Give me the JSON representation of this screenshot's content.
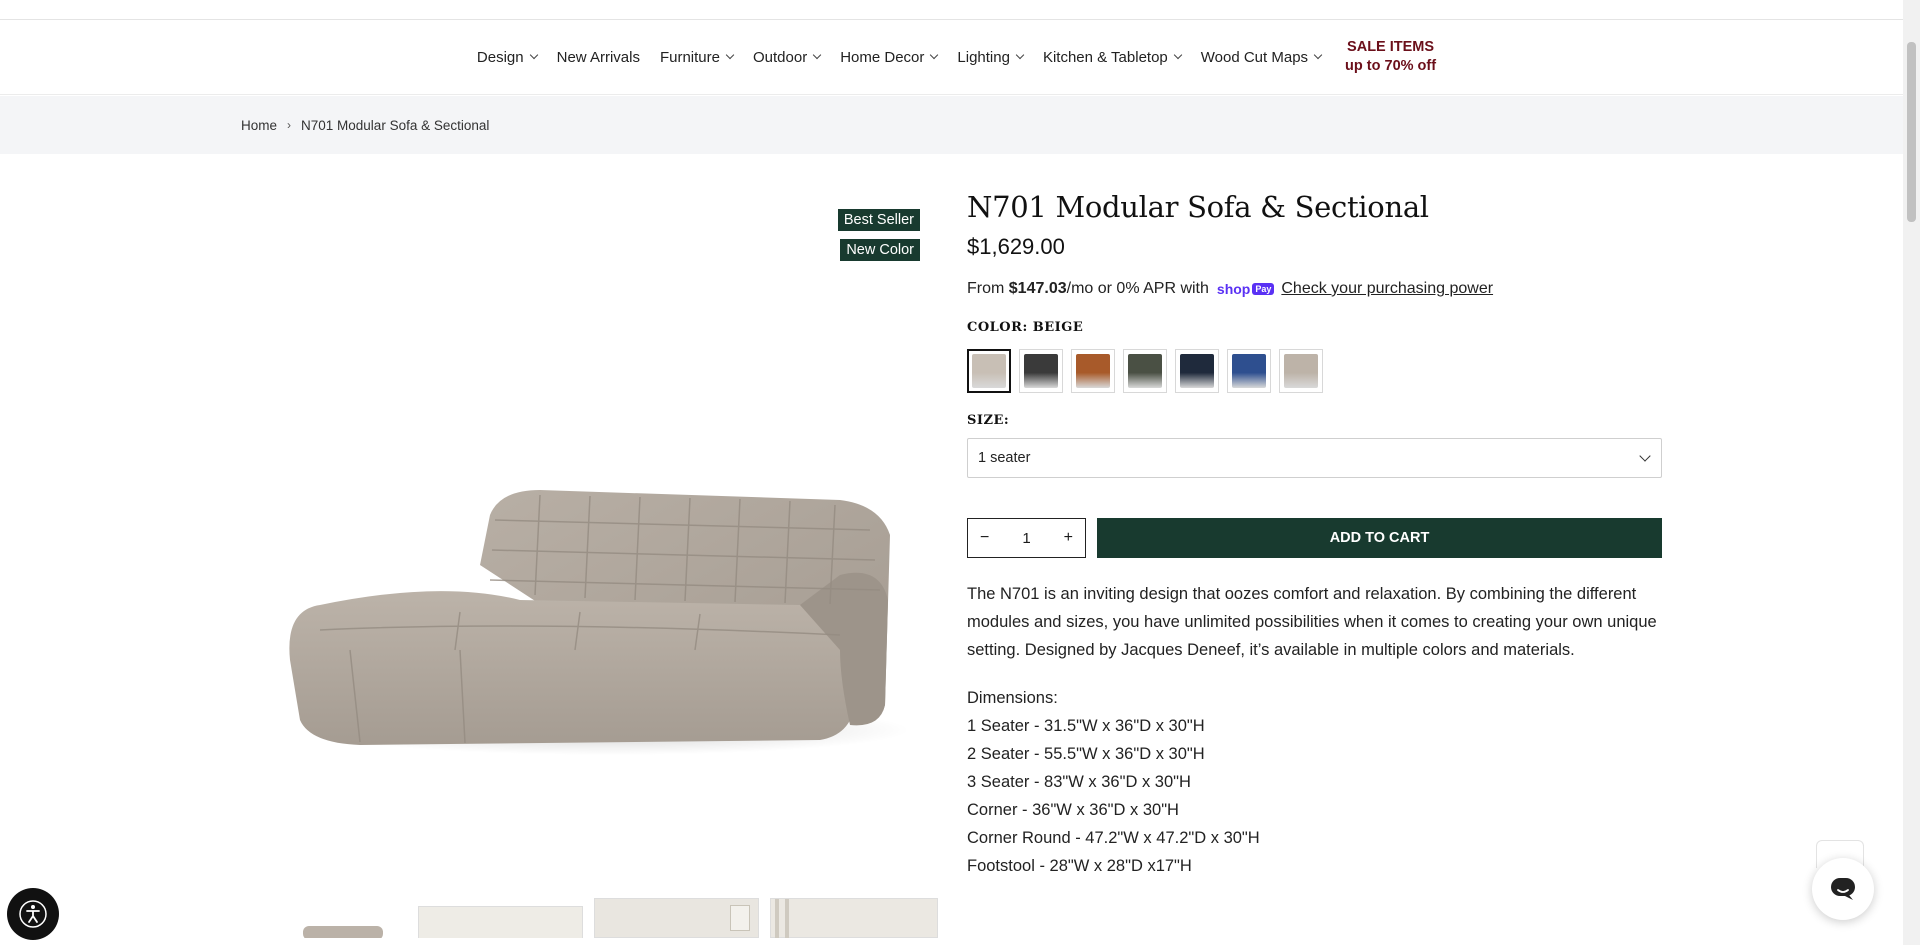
{
  "nav": {
    "items": [
      {
        "label": "Design",
        "dropdown": true
      },
      {
        "label": "New Arrivals",
        "dropdown": false
      },
      {
        "label": "Furniture",
        "dropdown": true
      },
      {
        "label": "Outdoor",
        "dropdown": true
      },
      {
        "label": "Home Decor",
        "dropdown": true
      },
      {
        "label": "Lighting",
        "dropdown": true
      },
      {
        "label": "Kitchen & Tabletop",
        "dropdown": true
      },
      {
        "label": "Wood Cut Maps",
        "dropdown": true
      }
    ],
    "sale_line1": "SALE ITEMS",
    "sale_line2": "up to 70% off"
  },
  "breadcrumb": {
    "home": "Home",
    "separator": "›",
    "current": "N701 Modular Sofa & Sectional"
  },
  "badges": {
    "best_seller": "Best Seller",
    "new_color": "New Color"
  },
  "product": {
    "title": "N701 Modular Sofa & Sectional",
    "price": "$1,629.00",
    "finance_from": "From",
    "finance_amount": "$147.03",
    "finance_rest": "/mo or 0% APR with",
    "shoppay_text": "shop",
    "shoppay_badge": "Pay",
    "finance_link": "Check your purchasing power",
    "color_label": "COLOR: BEIGE",
    "size_label": "SIZE:",
    "size_value": "1 seater",
    "qty_minus": "−",
    "qty_value": "1",
    "qty_plus": "+",
    "add_to_cart": "ADD TO CART",
    "description": "The N701 is an inviting design that oozes comfort and relaxation. By combining the different modules and sizes, you have unlimited possibilities when it comes to creating your own unique setting. Designed by Jacques Deneef, it’s available in multiple colors and materials.",
    "dimensions": [
      "Dimensions:",
      "1 Seater - 31.5\"W x 36\"D x 30\"H",
      "2 Seater - 55.5\"W x 36\"D x 30\"H",
      "3 Seater - 83\"W x 36\"D x 30\"H",
      "Corner - 36\"W x 36\"D x 30\"H",
      "Corner Round - 47.2\"W x 47.2\"D x 30\"H",
      "Footstool - 28\"W x 28\"D x17\"H"
    ]
  },
  "swatches": [
    {
      "name": "beige",
      "color": "#c8bfb5",
      "active": true
    },
    {
      "name": "charcoal",
      "color": "#3a3a3a",
      "active": false
    },
    {
      "name": "cognac",
      "color": "#a85a2a",
      "active": false
    },
    {
      "name": "olive",
      "color": "#4a5044",
      "active": false
    },
    {
      "name": "navy",
      "color": "#1f2a3c",
      "active": false
    },
    {
      "name": "blue",
      "color": "#2e4f8f",
      "active": false
    },
    {
      "name": "sand",
      "color": "#bdb3a8",
      "active": false
    }
  ],
  "colors": {
    "accent": "#183a2f",
    "sale": "#6b0f1a",
    "shoppay": "#5a31f4"
  }
}
